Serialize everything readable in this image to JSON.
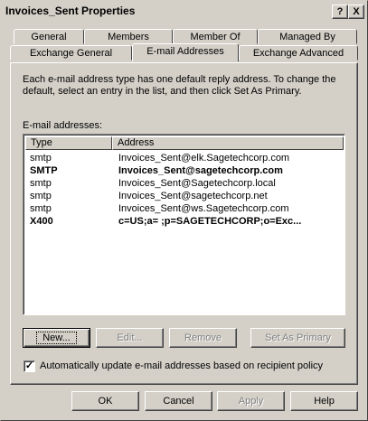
{
  "window": {
    "title": "Invoices_Sent Properties",
    "help_btn": "?",
    "close_btn": "X"
  },
  "tabs": {
    "row1": [
      "General",
      "Members",
      "Member Of",
      "Managed By"
    ],
    "row2": [
      "Exchange General",
      "E-mail Addresses",
      "Exchange Advanced"
    ],
    "active": "E-mail Addresses"
  },
  "panel": {
    "description": "Each e-mail address type has one default reply address. To change the default, select an entry in the list, and then click Set As Primary.",
    "list_label": "E-mail addresses:",
    "columns": [
      "Type",
      "Address"
    ],
    "rows": [
      {
        "type": "smtp",
        "address": "Invoices_Sent@elk.Sagetechcorp.com",
        "primary": false
      },
      {
        "type": "SMTP",
        "address": "Invoices_Sent@sagetechcorp.com",
        "primary": true
      },
      {
        "type": "smtp",
        "address": "Invoices_Sent@Sagetechcorp.local",
        "primary": false
      },
      {
        "type": "smtp",
        "address": "Invoices_Sent@sagetechcorp.net",
        "primary": false
      },
      {
        "type": "smtp",
        "address": "Invoices_Sent@ws.Sagetechcorp.com",
        "primary": false
      },
      {
        "type": "X400",
        "address": "c=US;a= ;p=SAGETECHCORP;o=Exc...",
        "primary": true
      }
    ],
    "buttons": {
      "new": "New...",
      "edit": "Edit...",
      "remove": "Remove",
      "set_primary": "Set As Primary"
    },
    "auto_update_label": "Automatically update e-mail addresses based on recipient policy",
    "auto_update_checked": true
  },
  "footer": {
    "ok": "OK",
    "cancel": "Cancel",
    "apply": "Apply",
    "help": "Help"
  }
}
